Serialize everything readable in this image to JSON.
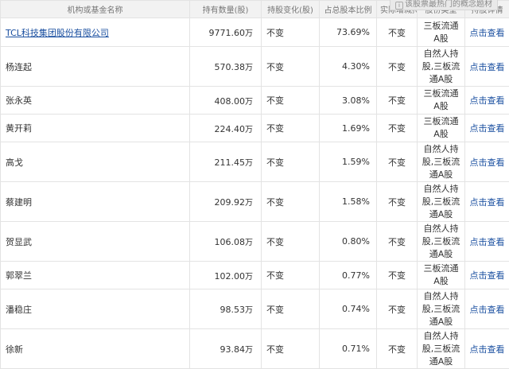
{
  "tooltip": "该股票最热门的概念题材",
  "headers": [
    "机构或基金名称",
    "持有数量(股)",
    "持股变化(股)",
    "占总股本比例",
    "实际增减持",
    "股份类型",
    "持股详情"
  ],
  "rows": [
    {
      "name": "TCL科技集团股份有限公司",
      "hold": "9771.60",
      "unit": "万",
      "change": "不变",
      "ratio": "73.69%",
      "actual": "不变",
      "type": "三板流通A股",
      "detail": "点击查看"
    },
    {
      "name": "杨连起",
      "hold": "570.38",
      "unit": "万",
      "change": "不变",
      "ratio": "4.30%",
      "actual": "不变",
      "type": "自然人持股,三板流通A股",
      "detail": "点击查看"
    },
    {
      "name": "张永英",
      "hold": "408.00",
      "unit": "万",
      "change": "不变",
      "ratio": "3.08%",
      "actual": "不变",
      "type": "三板流通A股",
      "detail": "点击查看"
    },
    {
      "name": "黄开莉",
      "hold": "224.40",
      "unit": "万",
      "change": "不变",
      "ratio": "1.69%",
      "actual": "不变",
      "type": "三板流通A股",
      "detail": "点击查看"
    },
    {
      "name": "高戈",
      "hold": "211.45",
      "unit": "万",
      "change": "不变",
      "ratio": "1.59%",
      "actual": "不变",
      "type": "自然人持股,三板流通A股",
      "detail": "点击查看"
    },
    {
      "name": "蔡建明",
      "hold": "209.92",
      "unit": "万",
      "change": "不变",
      "ratio": "1.58%",
      "actual": "不变",
      "type": "自然人持股,三板流通A股",
      "detail": "点击查看"
    },
    {
      "name": "贺显武",
      "hold": "106.08",
      "unit": "万",
      "change": "不变",
      "ratio": "0.80%",
      "actual": "不变",
      "type": "自然人持股,三板流通A股",
      "detail": "点击查看"
    },
    {
      "name": "郭翠兰",
      "hold": "102.00",
      "unit": "万",
      "change": "不变",
      "ratio": "0.77%",
      "actual": "不变",
      "type": "三板流通A股",
      "detail": "点击查看"
    },
    {
      "name": "潘稳庄",
      "hold": "98.53",
      "unit": "万",
      "change": "不变",
      "ratio": "0.74%",
      "actual": "不变",
      "type": "自然人持股,三板流通A股",
      "detail": "点击查看"
    },
    {
      "name": "徐新",
      "hold": "93.84",
      "unit": "万",
      "change": "不变",
      "ratio": "0.71%",
      "actual": "不变",
      "type": "自然人持股,三板流通A股",
      "detail": "点击查看"
    }
  ]
}
